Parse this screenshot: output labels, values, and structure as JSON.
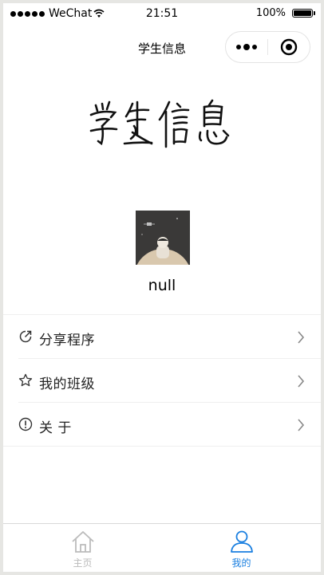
{
  "status_bar": {
    "carrier": "WeChat",
    "time": "21:51",
    "battery": "100%"
  },
  "nav": {
    "title": "学生信息"
  },
  "header": {
    "calligraphy_text": "学生信息"
  },
  "profile": {
    "name": "null"
  },
  "menu": {
    "items": [
      {
        "label": "分享程序",
        "icon": "share-icon"
      },
      {
        "label": "我的班级",
        "icon": "star-icon"
      },
      {
        "label": "关 于",
        "icon": "info-icon"
      }
    ]
  },
  "tabbar": {
    "tabs": [
      {
        "label": "主页",
        "icon": "home-icon",
        "active": false
      },
      {
        "label": "我的",
        "icon": "user-icon",
        "active": true
      }
    ]
  },
  "colors": {
    "active_tab": "#1a7fe0",
    "inactive_tab": "#bbbbbb",
    "background": "#ffffff"
  }
}
